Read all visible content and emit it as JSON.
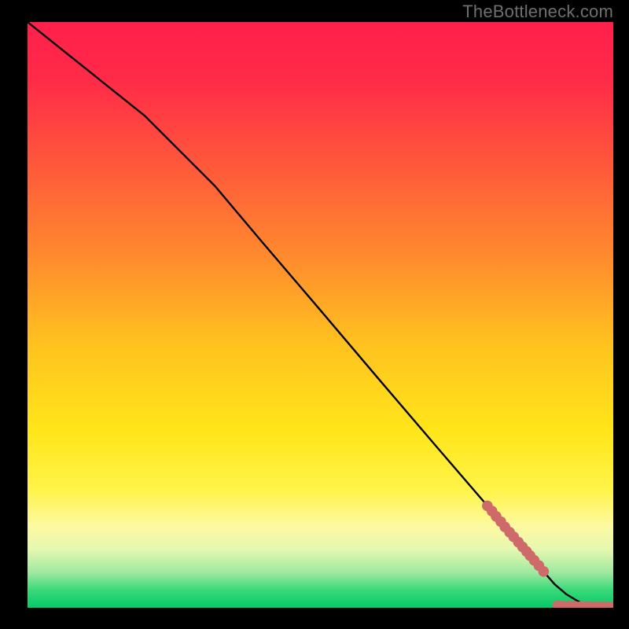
{
  "watermark": "TheBottleneck.com",
  "colors": {
    "gradient_stops": [
      {
        "offset": 0.0,
        "color": "#ff1f4b"
      },
      {
        "offset": 0.1,
        "color": "#ff2b48"
      },
      {
        "offset": 0.25,
        "color": "#ff5a3a"
      },
      {
        "offset": 0.4,
        "color": "#ff8a2e"
      },
      {
        "offset": 0.55,
        "color": "#ffc21f"
      },
      {
        "offset": 0.7,
        "color": "#ffe61a"
      },
      {
        "offset": 0.8,
        "color": "#fff44a"
      },
      {
        "offset": 0.86,
        "color": "#fdf9a0"
      },
      {
        "offset": 0.9,
        "color": "#e6f8b0"
      },
      {
        "offset": 0.94,
        "color": "#9fe8a0"
      },
      {
        "offset": 0.97,
        "color": "#38d977"
      },
      {
        "offset": 1.0,
        "color": "#06c96b"
      }
    ],
    "line": "#000000",
    "marker": "#cf6a6a"
  },
  "chart_data": {
    "type": "line",
    "title": "",
    "xlabel": "",
    "ylabel": "",
    "xlim": [
      0,
      100
    ],
    "ylim": [
      0,
      100
    ],
    "grid": false,
    "legend": false,
    "series": [
      {
        "name": "curve",
        "kind": "line",
        "x": [
          0,
          5,
          10,
          15,
          20,
          24,
          28,
          32,
          40,
          50,
          60,
          70,
          78,
          82,
          85,
          88,
          90,
          92,
          94,
          96,
          98,
          100
        ],
        "y": [
          100,
          96,
          92,
          88,
          84,
          80,
          76,
          72,
          62.5,
          50.8,
          39,
          27.3,
          18,
          13.2,
          9.8,
          6.3,
          4.0,
          2.3,
          1.1,
          0.45,
          0.12,
          0.04
        ]
      },
      {
        "name": "highlight-upper",
        "kind": "scatter",
        "x": [
          78.5,
          79.3,
          80.0,
          80.8,
          81.5,
          82.3,
          83.0,
          83.8,
          84.5,
          85.2,
          85.8,
          86.5,
          87.3,
          88.1
        ],
        "y": [
          17.4,
          16.5,
          15.6,
          14.7,
          13.8,
          12.9,
          12.1,
          11.2,
          10.4,
          9.6,
          8.9,
          8.1,
          7.2,
          6.2
        ]
      },
      {
        "name": "highlight-lower",
        "kind": "scatter",
        "x": [
          90.5,
          91.5,
          92.5,
          93.5,
          94.5,
          95.3,
          96.0,
          97.0,
          97.8,
          98.5,
          99.2,
          100.0
        ],
        "y": [
          0.35,
          0.3,
          0.28,
          0.25,
          0.22,
          0.2,
          0.19,
          0.17,
          0.15,
          0.14,
          0.13,
          0.12
        ]
      }
    ]
  }
}
